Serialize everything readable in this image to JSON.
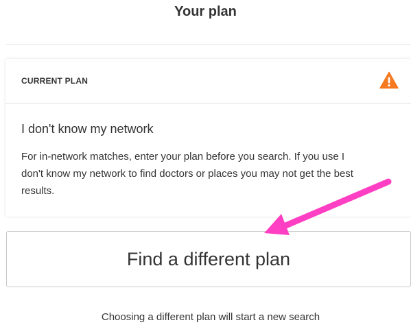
{
  "header": {
    "title": "Your plan"
  },
  "current_plan": {
    "label": "CURRENT PLAN",
    "status_icon": "warning-triangle-icon",
    "plan_name": "I don't know my network",
    "description": "For in-network matches, enter your plan before you search. If you use I don't know my network to find doctors or places you may not get the best results."
  },
  "actions": {
    "find_plan_label": "Find a different plan"
  },
  "footer": {
    "note": "Choosing a different plan will start a new search"
  },
  "colors": {
    "warning": "#f47920",
    "annotation_arrow": "#ff3fc3",
    "text": "#333333",
    "border": "#c8c8c8"
  }
}
